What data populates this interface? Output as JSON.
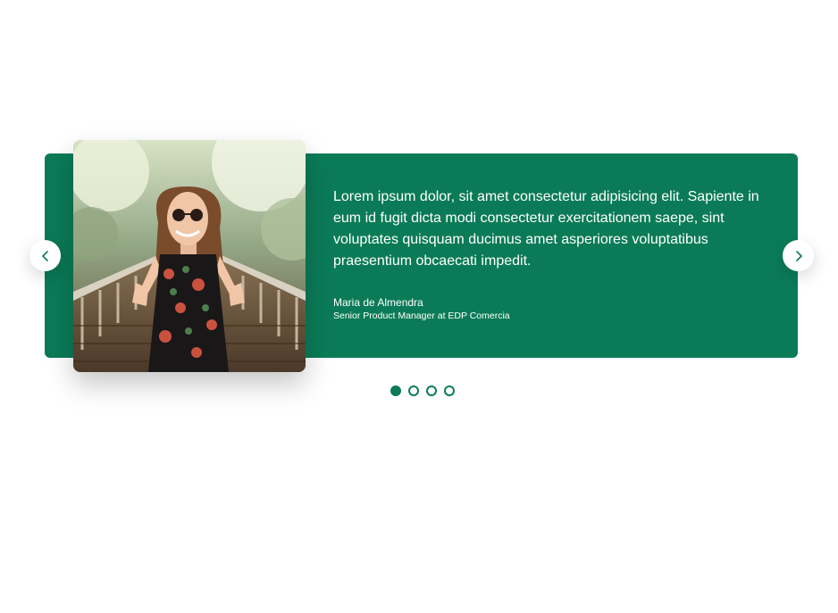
{
  "testimonial": {
    "quote": "Lorem ipsum dolor, sit amet consectetur adipisicing elit. Sapiente in eum id fugit dicta modi consectetur exercitationem saepe, sint voluptates quisquam ducimus amet asperiores voluptatibus praesentium obcaecati impedit.",
    "author_name": "Maria de Almendra",
    "author_role": "Senior Product Manager at EDP Comercia"
  },
  "carousel": {
    "slide_count": 4,
    "active_index": 0,
    "prev_icon": "chevron-left-icon",
    "next_icon": "chevron-right-icon"
  },
  "colors": {
    "accent": "#0b7b57",
    "text_on_accent": "#ffffff",
    "page_background": "#ffffff"
  }
}
